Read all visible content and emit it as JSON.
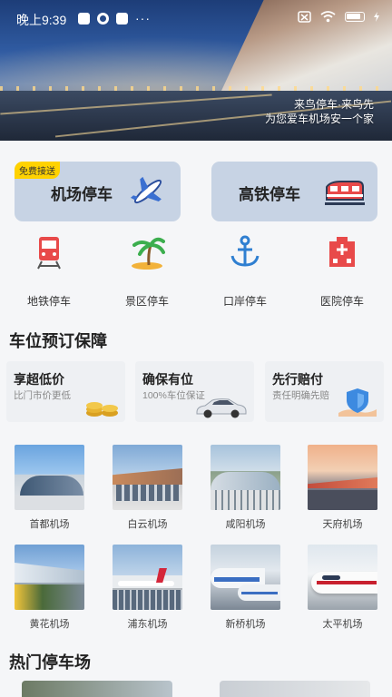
{
  "status_bar": {
    "time": "晚上9:39"
  },
  "hero": {
    "caption_line1": "来鸟停车·来鸟先",
    "caption_line2": "为您爱车机场安一个家"
  },
  "top_cards": [
    {
      "label": "机场停车",
      "badge": "免费接送",
      "icon": "airplane-icon"
    },
    {
      "label": "高铁停车",
      "icon": "train-icon"
    }
  ],
  "quick_links": [
    {
      "label": "地铁停车",
      "icon": "metro-icon"
    },
    {
      "label": "景区停车",
      "icon": "palm-tree-icon"
    },
    {
      "label": "口岸停车",
      "icon": "anchor-icon"
    },
    {
      "label": "医院停车",
      "icon": "hospital-icon"
    }
  ],
  "guarantee": {
    "title": "车位预订保障",
    "cards": [
      {
        "title": "享超低价",
        "subtitle": "比门市价更低",
        "icon": "coins-icon"
      },
      {
        "title": "确保有位",
        "subtitle": "100%车位保证",
        "icon": "car-icon"
      },
      {
        "title": "先行赔付",
        "subtitle": "责任明确先赔",
        "icon": "shield-icon"
      }
    ]
  },
  "airports": [
    {
      "name": "首都机场"
    },
    {
      "name": "白云机场"
    },
    {
      "name": "咸阳机场"
    },
    {
      "name": "天府机场"
    },
    {
      "name": "黄花机场"
    },
    {
      "name": "浦东机场"
    },
    {
      "name": "新桥机场"
    },
    {
      "name": "太平机场"
    }
  ],
  "hot_parking": {
    "title": "热门停车场"
  }
}
